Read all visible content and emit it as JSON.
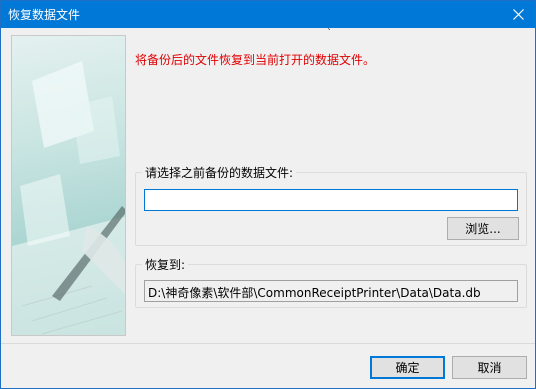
{
  "window": {
    "title": "恢复数据文件",
    "close_icon": "close-icon"
  },
  "main": {
    "tick_mark": "`",
    "info_text": "将备份后的文件恢复到当前打开的数据文件。"
  },
  "select_group": {
    "label": "请选择之前备份的数据文件:",
    "file_value": "",
    "browse_label": "浏览..."
  },
  "restore_group": {
    "label": "恢复到:",
    "path": "D:\\神奇像素\\软件部\\CommonReceiptPrinter\\Data\\Data.db"
  },
  "footer": {
    "ok_label": "确定",
    "cancel_label": "取消"
  },
  "colors": {
    "titlebar": "#0078d7",
    "info_text": "#e00000",
    "side_panel": "#a7d3cf"
  }
}
